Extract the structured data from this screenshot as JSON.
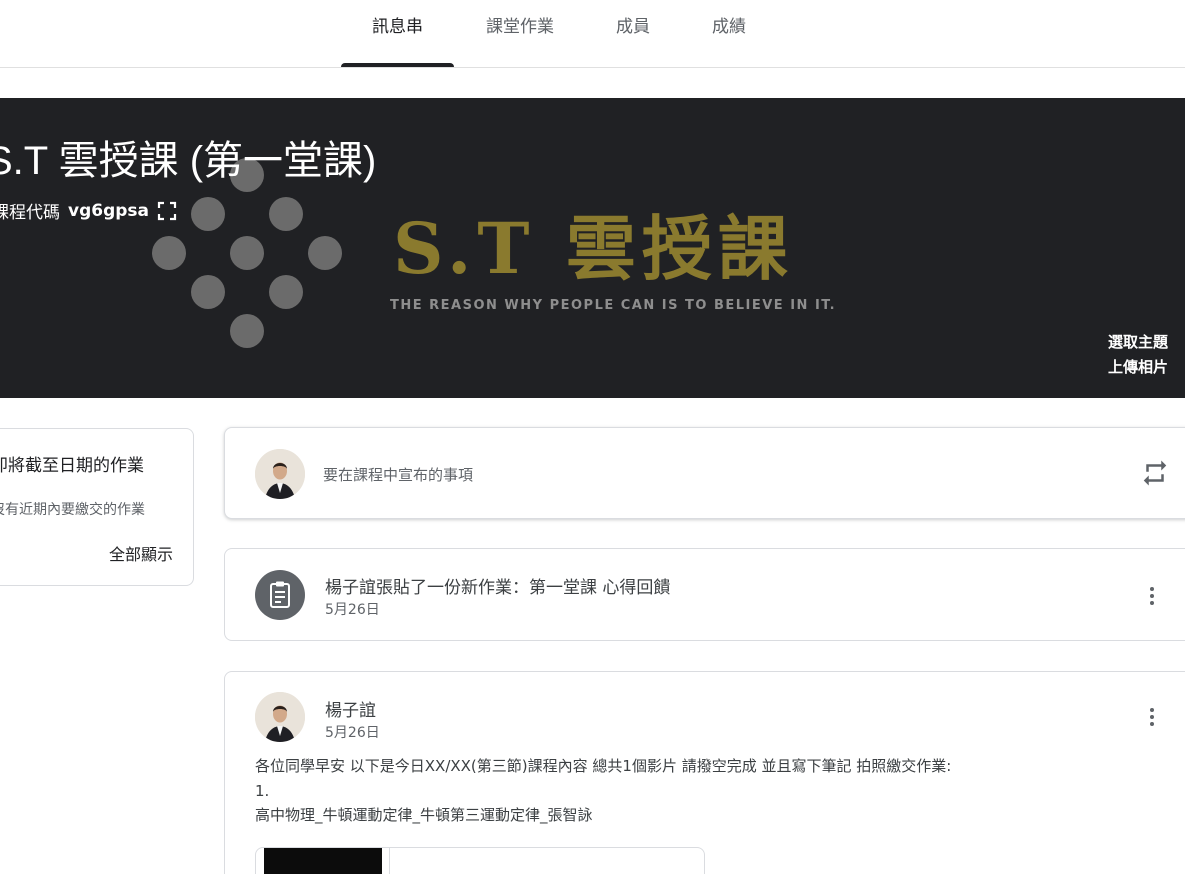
{
  "tabs": [
    {
      "label": "訊息串",
      "active": true
    },
    {
      "label": "課堂作業",
      "active": false
    },
    {
      "label": "成員",
      "active": false
    },
    {
      "label": "成績",
      "active": false
    }
  ],
  "banner": {
    "title": "S.T 雲授課 (第一堂課)",
    "code_label": "課程代碼",
    "code_value": "vg6gpsa",
    "logo_text": "S.T 雲授課",
    "logo_tagline": "THE REASON WHY PEOPLE CAN IS TO BELIEVE IN IT.",
    "select_theme": "選取主題",
    "upload_photo": "上傳相片",
    "background_color": "#202124",
    "logo_color": "#8a7a2e"
  },
  "upcoming": {
    "title": "即將截至日期的作業",
    "subtitle": "沒有近期內要繳交的作業",
    "view_all": "全部顯示"
  },
  "announce": {
    "placeholder": "要在課程中宣布的事項"
  },
  "assignment_post": {
    "title": "楊子誼張貼了一份新作業：第一堂課 心得回饋",
    "date": "5月26日"
  },
  "post": {
    "author": "楊子誼",
    "date": "5月26日",
    "body_line1": "各位同學早安 以下是今日XX/XX(第三節)課程內容 總共1個影片 請撥空完成 並且寫下筆記 拍照繳交作業:",
    "body_line2": "1.",
    "body_line3": "高中物理_牛頓運動定律_牛頓第三運動定律_張智詠"
  },
  "icons": {
    "expand": "expand-icon",
    "repost": "repost-icon",
    "assignment": "clipboard-icon",
    "more": "more-vert-icon"
  }
}
